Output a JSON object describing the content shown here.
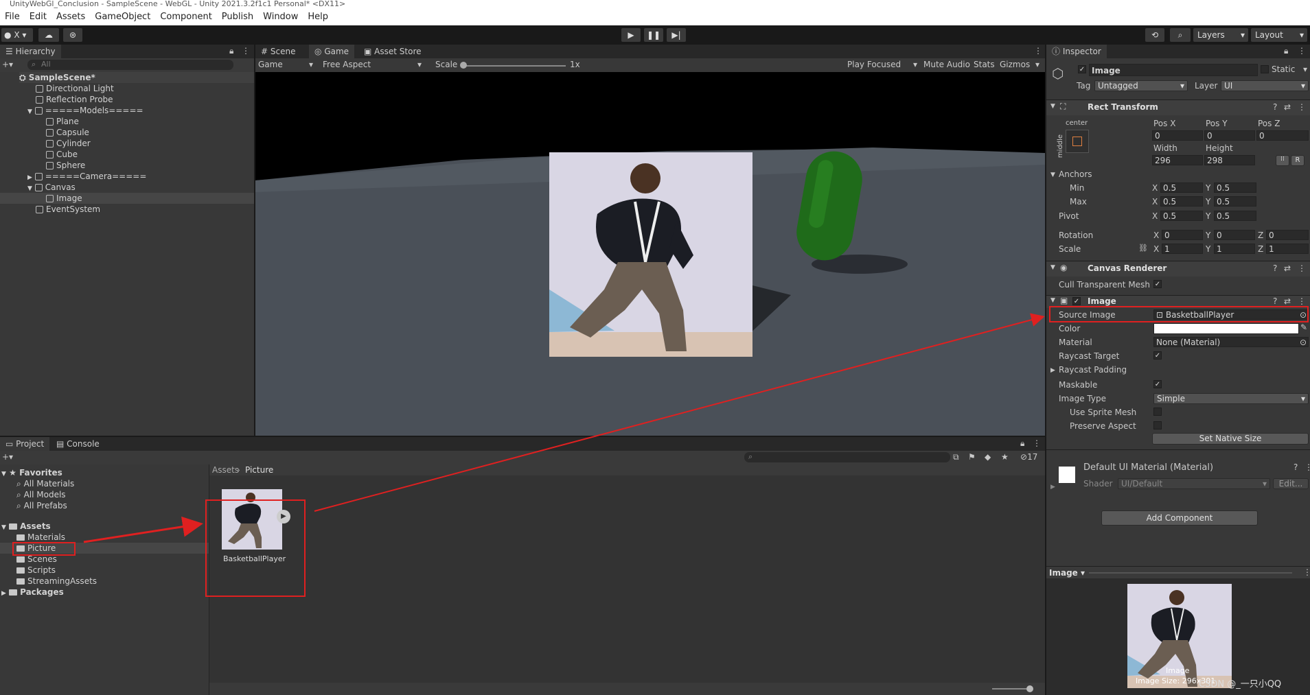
{
  "window": {
    "title": "UnityWebGl_Conclusion - SampleScene - WebGL - Unity 2021.3.2f1c1 Personal* <DX11>"
  },
  "menu": [
    "File",
    "Edit",
    "Assets",
    "GameObject",
    "Component",
    "Publish",
    "Window",
    "Help"
  ],
  "toolbar": {
    "account": "X",
    "layers": "Layers",
    "layout": "Layout"
  },
  "hierarchy": {
    "tab": "Hierarchy",
    "search_placeholder": "All",
    "scene": "SampleScene*",
    "items": [
      {
        "label": "Directional Light",
        "depth": 1
      },
      {
        "label": "Reflection Probe",
        "depth": 1
      },
      {
        "label": "=====Models=====",
        "depth": 1
      },
      {
        "label": "Plane",
        "depth": 2
      },
      {
        "label": "Capsule",
        "depth": 2
      },
      {
        "label": "Cylinder",
        "depth": 2
      },
      {
        "label": "Cube",
        "depth": 2
      },
      {
        "label": "Sphere",
        "depth": 2
      },
      {
        "label": "=====Camera=====",
        "depth": 1
      },
      {
        "label": "Canvas",
        "depth": 1
      },
      {
        "label": "Image",
        "depth": 2
      },
      {
        "label": "EventSystem",
        "depth": 1
      }
    ]
  },
  "scene_tabs": {
    "scene": "Scene",
    "game": "Game",
    "asset_store": "Asset Store"
  },
  "game_bar": {
    "display": "Game",
    "aspect": "Free Aspect",
    "scale_label": "Scale",
    "scale_value": "1x",
    "play_focused": "Play Focused",
    "mute": "Mute Audio",
    "stats": "Stats",
    "gizmos": "Gizmos"
  },
  "project": {
    "tab_project": "Project",
    "tab_console": "Console",
    "favorites": "Favorites",
    "fav_items": [
      "All Materials",
      "All Models",
      "All Prefabs"
    ],
    "assets": "Assets",
    "asset_folders": [
      "Materials",
      "Picture",
      "Scenes",
      "Scripts",
      "StreamingAssets"
    ],
    "packages": "Packages",
    "breadcrumb_root": "Assets",
    "breadcrumb_current": "Picture",
    "hidden_count": "17",
    "asset_name": "BasketballPlayer"
  },
  "inspector": {
    "tab": "Inspector",
    "object_name": "Image",
    "static_label": "Static",
    "tag_label": "Tag",
    "tag_value": "Untagged",
    "layer_label": "Layer",
    "layer_value": "UI",
    "rect_transform": {
      "title": "Rect Transform",
      "anchor_h": "center",
      "anchor_v": "middle",
      "posx_label": "Pos X",
      "posy_label": "Pos Y",
      "posz_label": "Pos Z",
      "posx": "0",
      "posy": "0",
      "posz": "0",
      "width_label": "Width",
      "height_label": "Height",
      "width": "296",
      "height": "298",
      "r_btn": "R",
      "anchors_label": "Anchors",
      "min_label": "Min",
      "max_label": "Max",
      "pivot_label": "Pivot",
      "min_x": "0.5",
      "min_y": "0.5",
      "max_x": "0.5",
      "max_y": "0.5",
      "pivot_x": "0.5",
      "pivot_y": "0.5",
      "rotation_label": "Rotation",
      "scale_label": "Scale",
      "rot_x": "0",
      "rot_y": "0",
      "rot_z": "0",
      "scale_x": "1",
      "scale_y": "1",
      "scale_z": "1",
      "x": "X",
      "y": "Y",
      "z": "Z"
    },
    "canvas_renderer": {
      "title": "Canvas Renderer",
      "cull_label": "Cull Transparent Mesh"
    },
    "image": {
      "title": "Image",
      "source_label": "Source Image",
      "source_value": "BasketballPlayer",
      "color_label": "Color",
      "material_label": "Material",
      "material_value": "None (Material)",
      "raycast_target": "Raycast Target",
      "raycast_padding": "Raycast Padding",
      "maskable": "Maskable",
      "image_type_label": "Image Type",
      "image_type_value": "Simple",
      "use_sprite_mesh": "Use Sprite Mesh",
      "preserve_aspect": "Preserve Aspect",
      "native_size_btn": "Set Native Size"
    },
    "material": {
      "title": "Default UI Material (Material)",
      "shader_label": "Shader",
      "shader_value": "UI/Default",
      "edit_btn": "Edit..."
    },
    "add_component": "Add Component",
    "preview": {
      "label": "Image",
      "caption": "Image",
      "size": "Image Size: 296x301",
      "watermark": "CSDN @_一只小QQ"
    }
  },
  "colors": {
    "accent_red": "#e02020",
    "bg_dark": "#282828",
    "panel": "#383838",
    "capsule": "#1f6b1a"
  }
}
